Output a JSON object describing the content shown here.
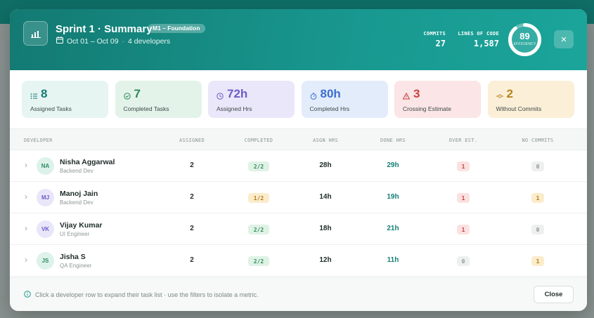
{
  "modal": {
    "title": "Sprint 1 · Summary",
    "badge": "M1 – Foundation",
    "dates": "Oct 01 – Oct 09",
    "developers": "4  developers",
    "commits_label": "COMMITS",
    "commits_value": "27",
    "loc_label": "LINES OF CODE",
    "loc_value": "1,587",
    "efficiency_value": "89",
    "efficiency_fraction": 0.89,
    "efficiency_label": "EFFICIENCY",
    "close_icon": "×"
  },
  "cards": [
    {
      "value": "8",
      "label": "Assigned Tasks",
      "icon": "list-icon",
      "bg": "#e6f4f2",
      "color": "#157e75"
    },
    {
      "value": "7",
      "label": "Completed Tasks",
      "icon": "check-circle-icon",
      "bg": "#e3f3ea",
      "color": "#2e8a55"
    },
    {
      "value": "72h",
      "label": "Assigned Hrs",
      "icon": "clock-icon",
      "bg": "#ebe7fa",
      "color": "#6b5cc9"
    },
    {
      "value": "80h",
      "label": "Completed Hrs",
      "icon": "timer-icon",
      "bg": "#e3ecfb",
      "color": "#3c6fcf"
    },
    {
      "value": "3",
      "label": "Crossing Estimate",
      "icon": "warning-icon",
      "bg": "#fbe5e6",
      "color": "#c8413f"
    },
    {
      "value": "2",
      "label": "Without Commits",
      "icon": "commit-icon",
      "bg": "#fbefd8",
      "color": "#b9831c"
    }
  ],
  "table": {
    "headers": [
      "DEVELOPER",
      "ASSIGNED",
      "COMPLETED",
      "ASGN HRS",
      "DONE HRS",
      "OVER EST.",
      "NO COMMITS"
    ],
    "rows": [
      {
        "initials": "NA",
        "name": "Nisha Aggarwal",
        "role": "Backend Dev",
        "assigned": "2",
        "completed": "2/2",
        "asgn_hrs": "28h",
        "done_hrs": "29h",
        "over_est": "1",
        "no_commits": "0",
        "avatar_bg": "#dcf2ea",
        "avatar_fg": "#2f8a63",
        "completed_style": "green",
        "over_style": "red",
        "nocommit_style": "gray"
      },
      {
        "initials": "MJ",
        "name": "Manoj Jain",
        "role": "Backend Dev",
        "assigned": "2",
        "completed": "1/2",
        "asgn_hrs": "14h",
        "done_hrs": "19h",
        "over_est": "1",
        "no_commits": "1",
        "avatar_bg": "#e9e6fa",
        "avatar_fg": "#6a5bc6",
        "completed_style": "amber",
        "over_style": "red",
        "nocommit_style": "amber"
      },
      {
        "initials": "VK",
        "name": "Vijay Kumar",
        "role": "UI Engineer",
        "assigned": "2",
        "completed": "2/2",
        "asgn_hrs": "18h",
        "done_hrs": "21h",
        "over_est": "1",
        "no_commits": "0",
        "avatar_bg": "#e9e6fa",
        "avatar_fg": "#6a5bc6",
        "completed_style": "green",
        "over_style": "red",
        "nocommit_style": "gray"
      },
      {
        "initials": "JS",
        "name": "Jisha S",
        "role": "QA Engineer",
        "assigned": "2",
        "completed": "2/2",
        "asgn_hrs": "12h",
        "done_hrs": "11h",
        "over_est": "0",
        "no_commits": "1",
        "avatar_bg": "#dcf2ea",
        "avatar_fg": "#2f8a63",
        "completed_style": "green",
        "over_style": "gray",
        "nocommit_style": "amber"
      }
    ]
  },
  "footer": {
    "info": "Click a developer row to expand their task list · use the filters to isolate a metric.",
    "close_label": "Close"
  },
  "colors": {
    "accent": "#189890",
    "done_hrs": "#157e75"
  }
}
